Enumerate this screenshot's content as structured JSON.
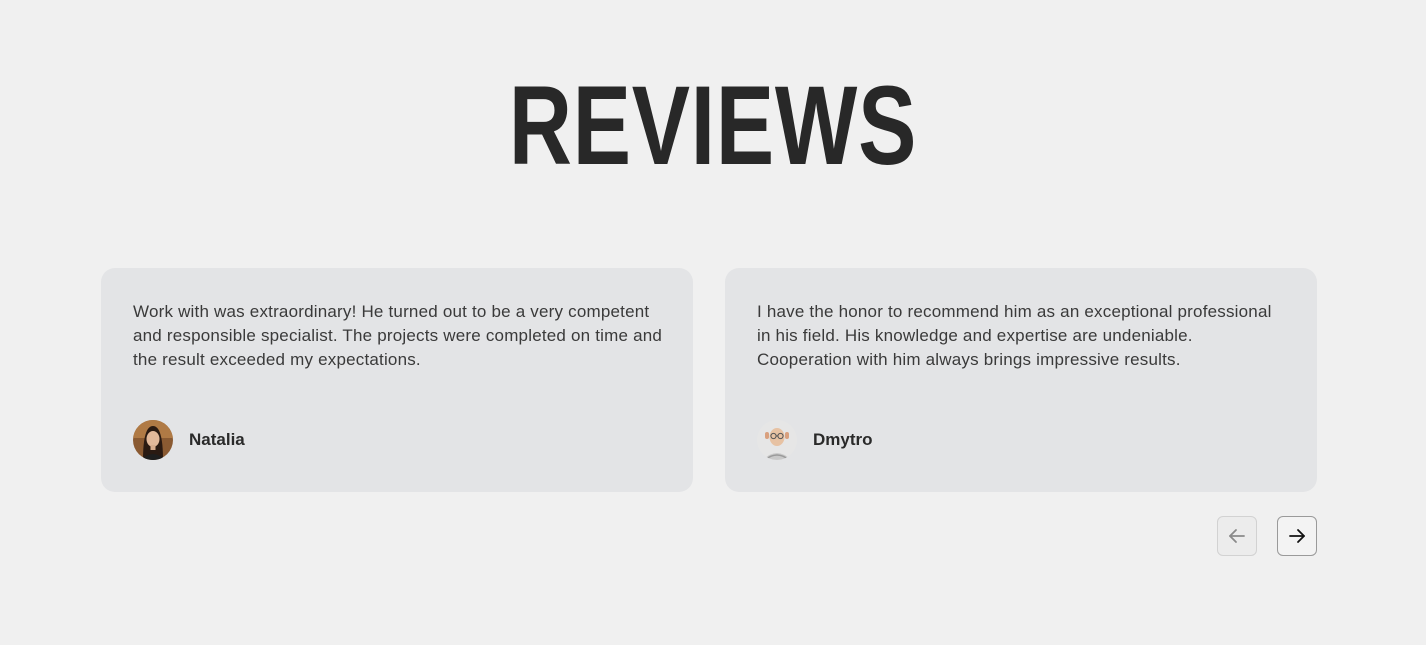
{
  "section": {
    "title": "REVIEWS"
  },
  "reviews": [
    {
      "text": "Work with was extraordinary! He turned out to be a very competent and responsible specialist. The projects were completed on time and the result exceeded my expectations.",
      "author": "Natalia",
      "avatar_icon": "avatar-photo-natalia"
    },
    {
      "text": "I have the honor to recommend him as an exceptional professional in his field. His knowledge and expertise are undeniable. Cooperation with him always brings impressive results.",
      "author": "Dmytro",
      "avatar_icon": "avatar-photo-dmytro"
    }
  ],
  "navigation": {
    "prev_icon": "arrow-left-icon",
    "next_icon": "arrow-right-icon",
    "prev_disabled": true
  },
  "colors": {
    "background": "#f0f0f0",
    "card": "#e3e4e6",
    "title": "#282828",
    "text": "#3a3a3a"
  }
}
